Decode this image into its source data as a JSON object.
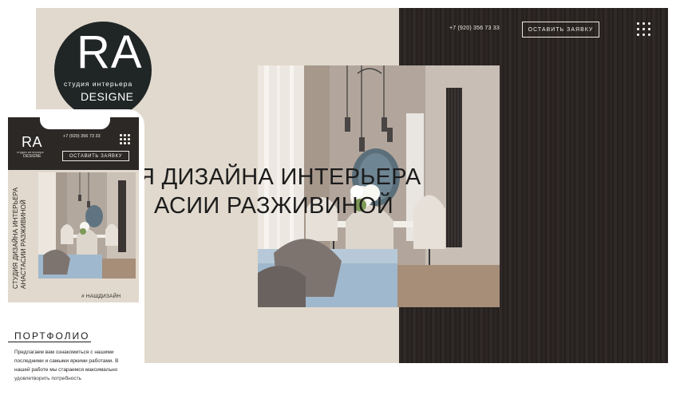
{
  "desktop": {
    "phone": "+7 (920) 356 73 33",
    "cta": "ОСТАВИТЬ ЗАЯВКУ",
    "logo": {
      "mark": "RA",
      "subtitle": "студия интерьера",
      "design": "DESIGNE"
    },
    "hero": {
      "line1": "Я ДИЗАЙНА ИНТЕРЬЕРА",
      "line2": "АСИИ РАЗЖИВИНОЙ"
    }
  },
  "mobile": {
    "logo": {
      "mark": "RA",
      "subtitle": "студия интерьера",
      "design": "DESIGNE"
    },
    "phone": "+7 (920) 356 73 33",
    "cta": "ОСТАВИТЬ ЗАЯВКУ",
    "vertical_title": {
      "line1": "СТУДИЯ ДИЗАЙНА ИНТЕРЬЕРА",
      "line2": "АНАСТАСИИ РАЗЖИВИНОЙ"
    },
    "hashtag": "# НАШДИЗАЙН",
    "portfolio_heading": "ПОРТФОЛИО",
    "portfolio_text": "Предлагаем вам ознакомиться с нашими последними и самыми яркими работами. В нашей работе мы стараемся максимально удовлетворить потребность"
  },
  "colors": {
    "beige": "#e1d9cd",
    "dark_wood": "#2c2624",
    "logo_bg": "#202526",
    "text_dark": "#1c1c1c"
  },
  "icons": [
    "menu-dots-icon",
    "menu-dots-icon"
  ]
}
